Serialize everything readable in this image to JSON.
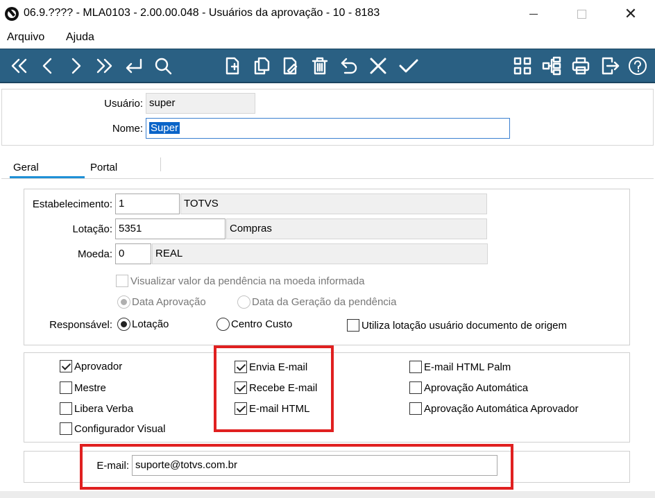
{
  "window": {
    "title": "06.9.???? - MLA0103 - 2.00.00.048 - Usuários da aprovação - 10 - 8183",
    "minimize_icon": "minimize-icon",
    "maximize_icon": "maximize-icon",
    "close_glyph": "✕"
  },
  "menu": {
    "items": [
      "Arquivo",
      "Ajuda"
    ]
  },
  "toolbar": {
    "background": "#2a6083",
    "buttons": [
      "first-icon",
      "previous-icon",
      "next-icon",
      "last-icon",
      "goto-icon",
      "search-icon",
      "new-icon",
      "copy-icon",
      "edit-icon",
      "delete-icon",
      "undo-icon",
      "cancel-icon",
      "save-icon",
      "grid-icon",
      "tree-icon",
      "print-icon",
      "exit-icon",
      "help-icon"
    ]
  },
  "header": {
    "usuario_label": "Usuário:",
    "usuario_value": "super",
    "nome_label": "Nome:",
    "nome_value": "Super"
  },
  "tabs": [
    {
      "label": "Geral",
      "active": true
    },
    {
      "label": "Portal",
      "active": false
    }
  ],
  "geral": {
    "estabelecimento": {
      "label": "Estabelecimento:",
      "code": "1",
      "description": "TOTVS"
    },
    "lotacao": {
      "label": "Lotação:",
      "code": "5351",
      "description": "Compras"
    },
    "moeda": {
      "label": "Moeda:",
      "code": "0",
      "description": "REAL"
    },
    "visualizar_valor": {
      "label": "Visualizar valor da pendência na moeda informada",
      "checked": false,
      "enabled": false
    },
    "data_radio": [
      {
        "label": "Data Aprovação",
        "checked": true,
        "enabled": false
      },
      {
        "label": "Data da Geração da pendência",
        "checked": false,
        "enabled": false
      }
    ],
    "responsavel": {
      "label": "Responsável:",
      "options": [
        {
          "label": "Lotação",
          "checked": true
        },
        {
          "label": "Centro Custo",
          "checked": false
        }
      ]
    },
    "utiliza_lotacao": {
      "label": "Utiliza lotação usuário documento de origem",
      "checked": false
    }
  },
  "flags": {
    "col1": [
      {
        "label": "Aprovador",
        "checked": true
      },
      {
        "label": "Mestre",
        "checked": false
      },
      {
        "label": "Libera Verba",
        "checked": false
      },
      {
        "label": "Configurador Visual",
        "checked": false
      }
    ],
    "col2": [
      {
        "label": "Envia E-mail",
        "checked": true
      },
      {
        "label": "Recebe E-mail",
        "checked": true
      },
      {
        "label": "E-mail HTML",
        "checked": true
      }
    ],
    "col3": [
      {
        "label": "E-mail HTML Palm",
        "checked": false
      },
      {
        "label": "Aprovação Automática",
        "checked": false
      },
      {
        "label": "Aprovação Automática Aprovador",
        "checked": false
      }
    ]
  },
  "email": {
    "label": "E-mail:",
    "value": "suporte@totvs.com.br"
  },
  "highlight_color": "#e02020"
}
